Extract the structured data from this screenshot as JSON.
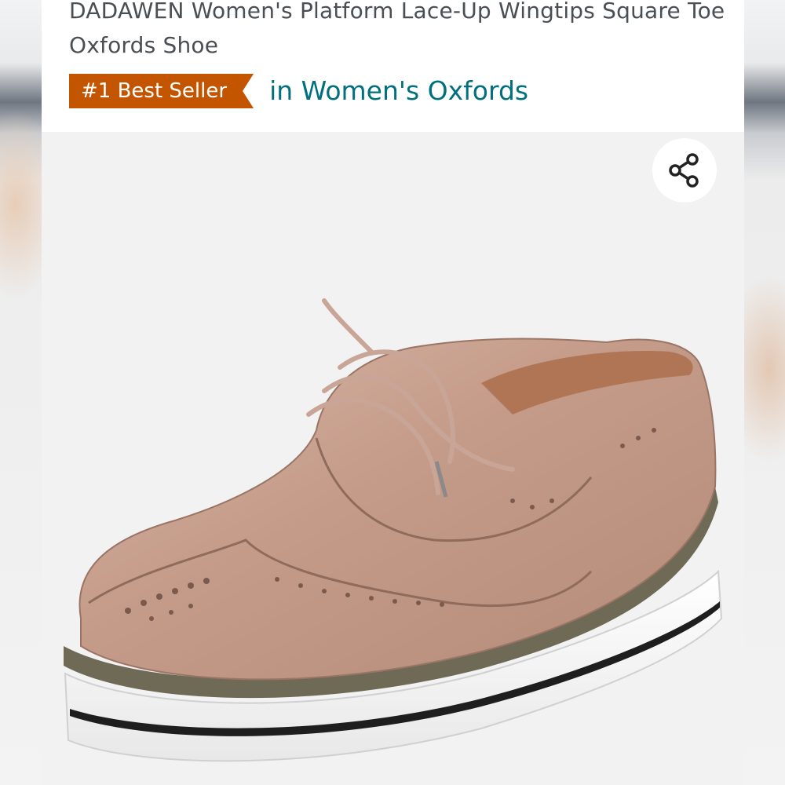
{
  "product": {
    "title": "DADAWEN Women's Platform Lace-Up Wingtips Square Toe Oxfords Shoe",
    "badge": "#1 Best Seller",
    "category": "in Women's Oxfords"
  },
  "icons": {
    "share": "share-icon"
  },
  "colors": {
    "badge_bg": "#c45500",
    "category_link": "#00707e",
    "title_text": "#4a4f54"
  }
}
